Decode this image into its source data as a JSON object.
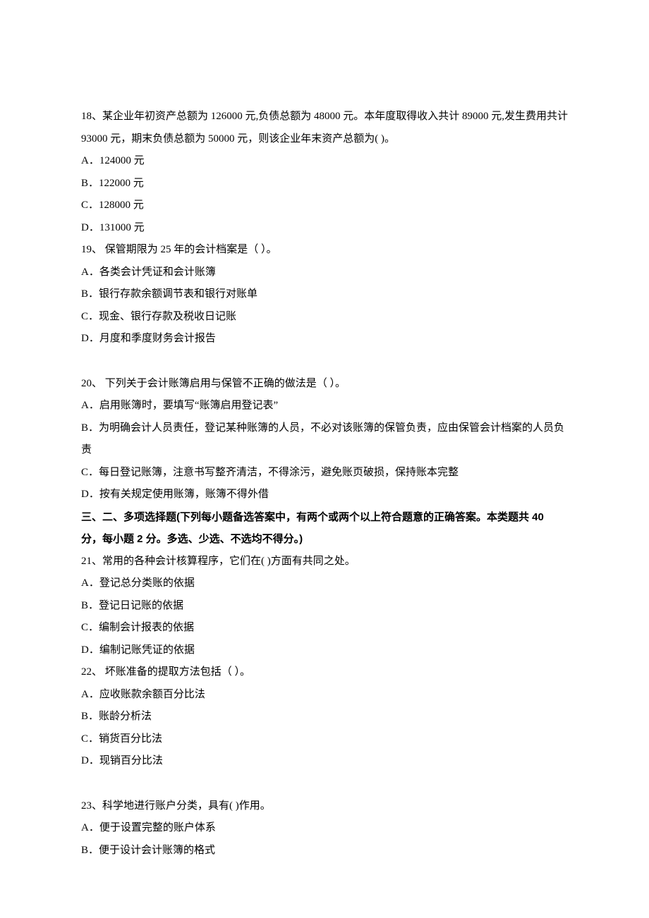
{
  "q18": {
    "text": "18、某企业年初资产总额为 126000 元,负债总额为 48000 元。本年度取得收入共计 89000 元,发生费用共计 93000 元，期末负债总额为 50000 元，则该企业年末资产总额为( )。",
    "a": "A．124000 元",
    "b": "B．122000 元",
    "c": "C．128000 元",
    "d": "D．131000 元"
  },
  "q19": {
    "text": "19、 保管期限为 25 年的会计档案是（    ）。",
    "a": "A．各类会计凭证和会计账簿",
    "b": "B．银行存款余额调节表和银行对账单",
    "c": "C．现金、银行存款及税收日记账",
    "d": "D．月度和季度财务会计报告"
  },
  "q20": {
    "text": "20、 下列关于会计账簿启用与保管不正确的做法是（    ）。",
    "a": "A．启用账簿时，要填写“账簿启用登记表”",
    "b": "B．为明确会计人员责任，登记某种账簿的人员，不必对该账簿的保管负责，应由保管会计档案的人员负责",
    "c": "C．每日登记账簿，注意书写整齐清洁，不得涂污，避免账页破损，保持账本完整",
    "d": "D．按有关规定使用账簿，账簿不得外借"
  },
  "section3": {
    "title": "三、二、多项选择题(下列每小题备选答案中，有两个或两个以上符合题意的正确答案。本类题共 40 分，每小题 2 分。多选、少选、不选均不得分。)"
  },
  "q21": {
    "text": "21、常用的各种会计核算程序，它们在( )方面有共同之处。",
    "a": "A．登记总分类账的依据",
    "b": "B．登记日记账的依据",
    "c": "C．编制会计报表的依据",
    "d": "D．编制记账凭证的依据"
  },
  "q22": {
    "text": "22、 坏账准备的提取方法包括（    ）。",
    "a": "A．应收账款余额百分比法",
    "b": "B．账龄分析法",
    "c": "C．销货百分比法",
    "d": "D．现销百分比法"
  },
  "q23": {
    "text": "23、科学地进行账户分类，具有( )作用。",
    "a": "A．便于设置完整的账户体系",
    "b": "B．便于设计会计账簿的格式"
  }
}
